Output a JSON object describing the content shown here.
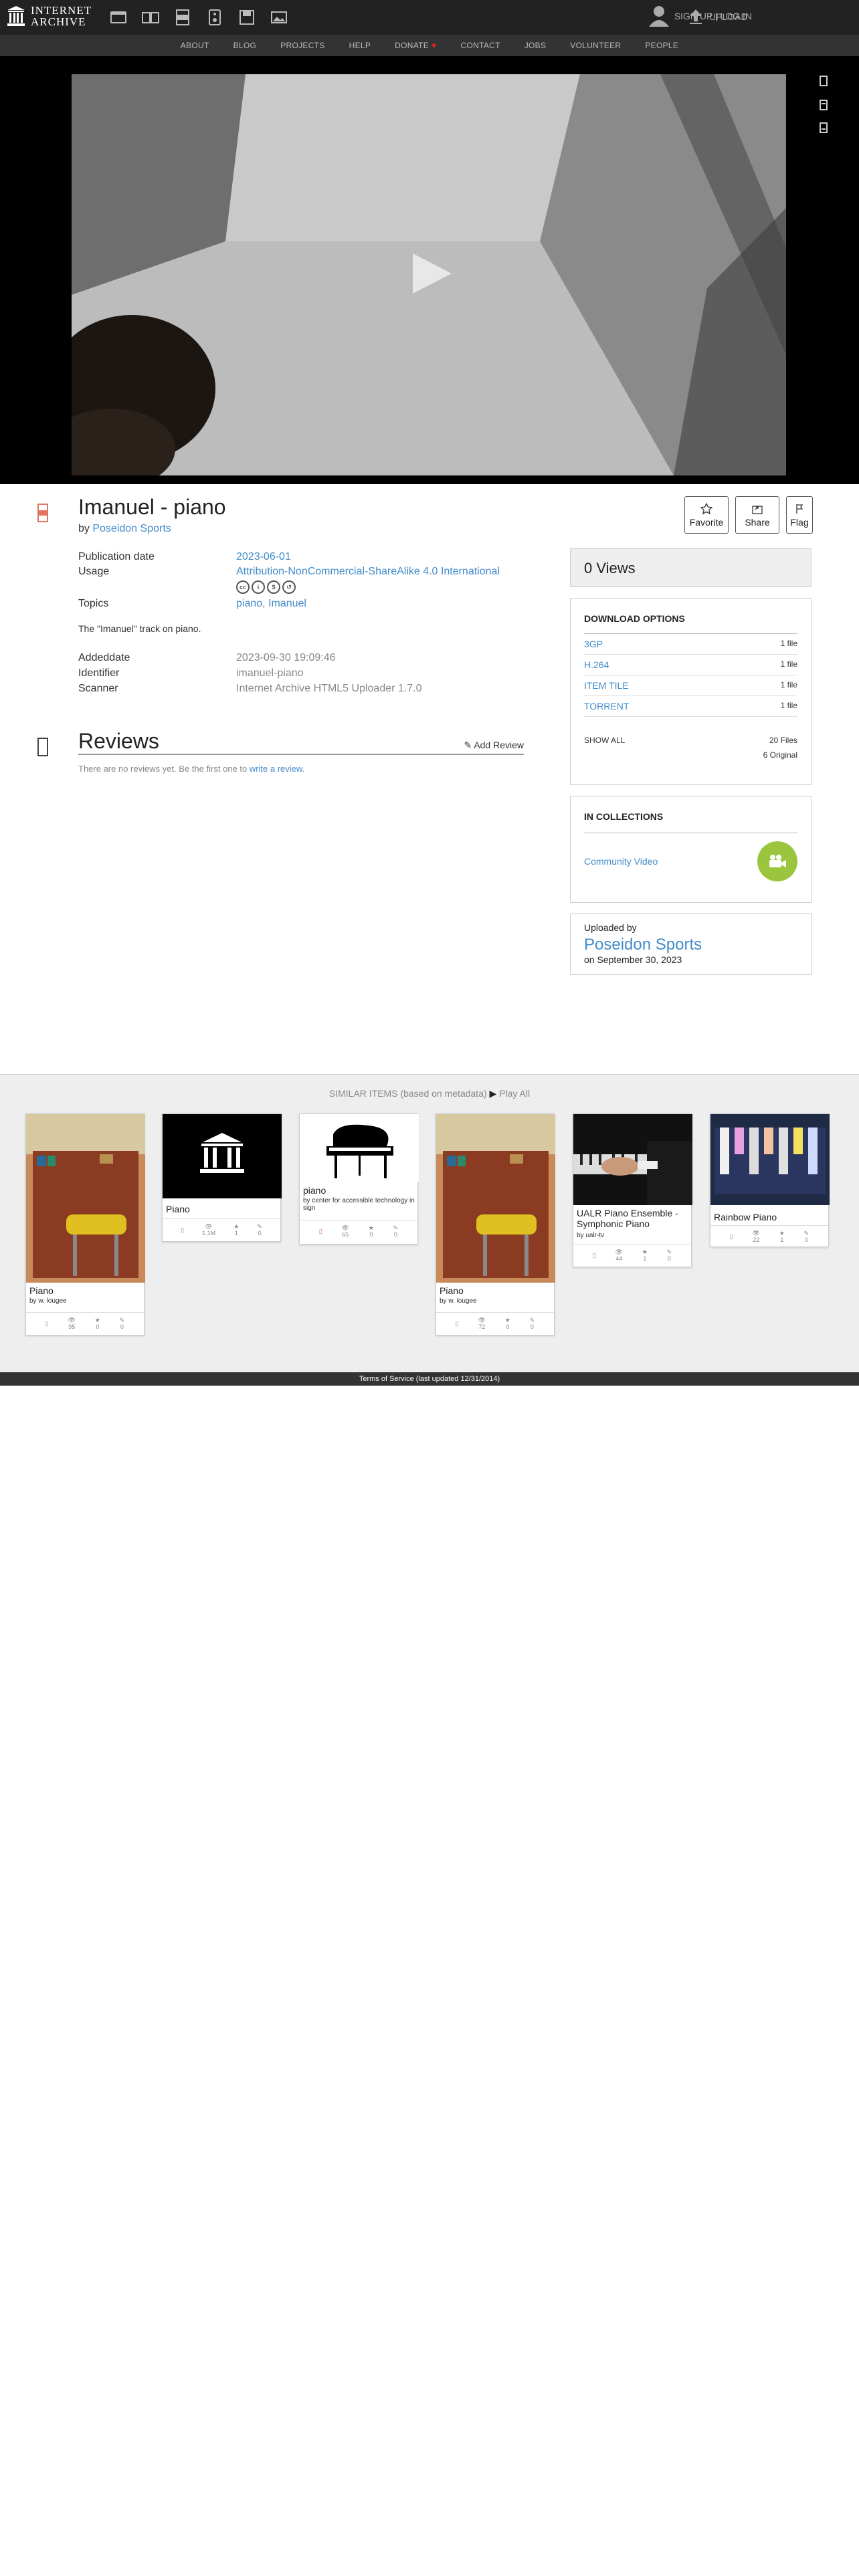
{
  "nav": {
    "logo_line1": "INTERNET",
    "logo_line2": "ARCHIVE",
    "signup": "SIGN UP | LOG IN",
    "upload": "UPLOAD",
    "links": [
      "ABOUT",
      "BLOG",
      "PROJECTS",
      "HELP",
      "DONATE",
      "CONTACT",
      "JOBS",
      "VOLUNTEER",
      "PEOPLE"
    ]
  },
  "item": {
    "title": "Imanuel - piano",
    "by_label": "by",
    "creator": "Poseidon Sports",
    "actions": {
      "favorite": "Favorite",
      "share": "Share",
      "flag": "Flag"
    },
    "meta": {
      "pubdate_k": "Publication date",
      "pubdate_v": "2023-06-01",
      "usage_k": "Usage",
      "usage_v": "Attribution-NonCommercial-ShareAlike 4.0 International",
      "topics_k": "Topics",
      "topics_v1": "piano",
      "topics_sep": ",",
      "topics_v2": "Imanuel"
    },
    "description": "The \"Imanuel\" track on piano.",
    "meta2": {
      "added_k": "Addeddate",
      "added_v": "2023-09-30 19:09:46",
      "id_k": "Identifier",
      "id_v": "imanuel-piano",
      "scanner_k": "Scanner",
      "scanner_v": "Internet Archive HTML5 Uploader 1.7.0"
    }
  },
  "reviews": {
    "title": "Reviews",
    "add": "Add Review",
    "none_text": "There are no reviews yet. Be the first one to",
    "none_link": "write a review",
    "none_end": "."
  },
  "sidebar": {
    "views": "0 Views",
    "download_title": "DOWNLOAD OPTIONS",
    "downloads": [
      {
        "name": "3GP",
        "count": "1 file"
      },
      {
        "name": "H.264",
        "count": "1 file"
      },
      {
        "name": "ITEM TILE",
        "count": "1 file"
      },
      {
        "name": "TORRENT",
        "count": "1 file"
      }
    ],
    "show_all": "SHOW ALL",
    "files": "20 Files",
    "original": "6 Original",
    "collections_title": "IN COLLECTIONS",
    "collection": "Community Video",
    "uploaded_by": "Uploaded by",
    "uploader": "Poseidon Sports",
    "uploaded_on": "on September 30, 2023"
  },
  "similar": {
    "title": "SIMILAR ITEMS (based on metadata)",
    "play_all": "Play All",
    "tiles": [
      {
        "title": "Piano",
        "by": "by w. lougee",
        "views": "7",
        "views2": "95",
        "favs": "0",
        "revs": "0"
      },
      {
        "title": "Piano",
        "by": "",
        "views": "1.1M",
        "favs": "1",
        "revs": "0"
      },
      {
        "title": "piano",
        "by": "by center for accessible technology in sign",
        "views": "65",
        "favs": "0",
        "revs": "0"
      },
      {
        "title": "Piano",
        "by": "by w. lougee",
        "views": "72",
        "favs": "0",
        "revs": "0"
      },
      {
        "title": "UALR Piano Ensemble - Symphonic Piano",
        "by": "by ualr-tv",
        "views": "44",
        "favs": "1",
        "revs": "0"
      },
      {
        "title": "Rainbow Piano",
        "by": "",
        "views": "22",
        "favs": "1",
        "revs": "0"
      }
    ]
  },
  "footer": "Terms of Service (last updated 12/31/2014)",
  "colors": {
    "accent": "#428bca",
    "collection_badge": "#9bc53d",
    "heart": "#e02020"
  }
}
